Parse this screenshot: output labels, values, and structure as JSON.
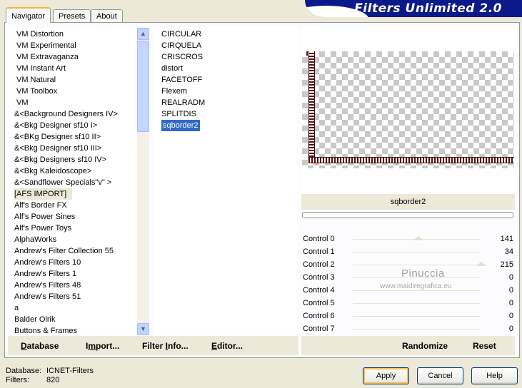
{
  "tabs": [
    {
      "label": "Navigator",
      "active": true
    },
    {
      "label": "Presets",
      "active": false
    },
    {
      "label": "About",
      "active": false
    }
  ],
  "banner": {
    "title": "Filters Unlimited 2.0"
  },
  "categories": [
    "VM Distortion",
    "VM Experimental",
    "VM Extravaganza",
    "VM Instant Art",
    "VM Natural",
    "VM Toolbox",
    "VM",
    "&<Background Designers IV>",
    "&<Bkg Designer sf10 I>",
    "&<BKg Designer sf10 II>",
    "&<Bkg Designer sf10 III>",
    "&<Bkg Designers sf10 IV>",
    "&<Bkg Kaleidoscope>",
    "&<Sandflower Specials\"v\" >",
    "[AFS IMPORT]",
    "Alf's Border FX",
    "Alf's Power Sines",
    "Alf's Power Toys",
    "AlphaWorks",
    "Andrew's Filter Collection 55",
    "Andrew's Filters 10",
    "Andrew's Filters 1",
    "Andrew's Filters 48",
    "Andrew's Filters 51",
    "a",
    "Balder Olrik",
    "Buttons & Frames"
  ],
  "highlighted_category": "[AFS IMPORT]",
  "filters": [
    "CIRCULAR",
    "CIRQUELA",
    "CRISCROS",
    "distort",
    "FACETOFF",
    "Flexem",
    "REALRADM",
    "SPLITDIS",
    "sqborder2"
  ],
  "selected_filter": "sqborder2",
  "filter_title": "sqborder2",
  "progress": 0,
  "controls": [
    {
      "label": "Control 0",
      "value": 141
    },
    {
      "label": "Control 1",
      "value": 34
    },
    {
      "label": "Control 2",
      "value": 215
    },
    {
      "label": "Control 3",
      "value": 0
    },
    {
      "label": "Control 4",
      "value": 0
    },
    {
      "label": "Control 5",
      "value": 0
    },
    {
      "label": "Control 6",
      "value": 0
    },
    {
      "label": "Control 7",
      "value": 0
    }
  ],
  "watermark": {
    "name": "Pinuccia",
    "url": "www.maidiregrafica.eu"
  },
  "actions": {
    "database": {
      "u": "D",
      "rest": "atabase"
    },
    "import": {
      "pre": "I",
      "u": "m",
      "rest": "port..."
    },
    "filter_info": {
      "pre": "Filter ",
      "u": "I",
      "rest": "nfo..."
    },
    "editor": {
      "u": "E",
      "rest": "ditor..."
    }
  },
  "randomize": "Randomize",
  "reset": "Reset",
  "footer": {
    "database_label": "Database:",
    "database_value": "ICNET-Filters",
    "filters_label": "Filters:",
    "filters_value": "820"
  },
  "buttons": {
    "apply": "Apply",
    "cancel": "Cancel",
    "help": "Help"
  },
  "icons": {
    "scroll_up": "chevron-up-icon",
    "scroll_down": "chevron-down-icon"
  }
}
